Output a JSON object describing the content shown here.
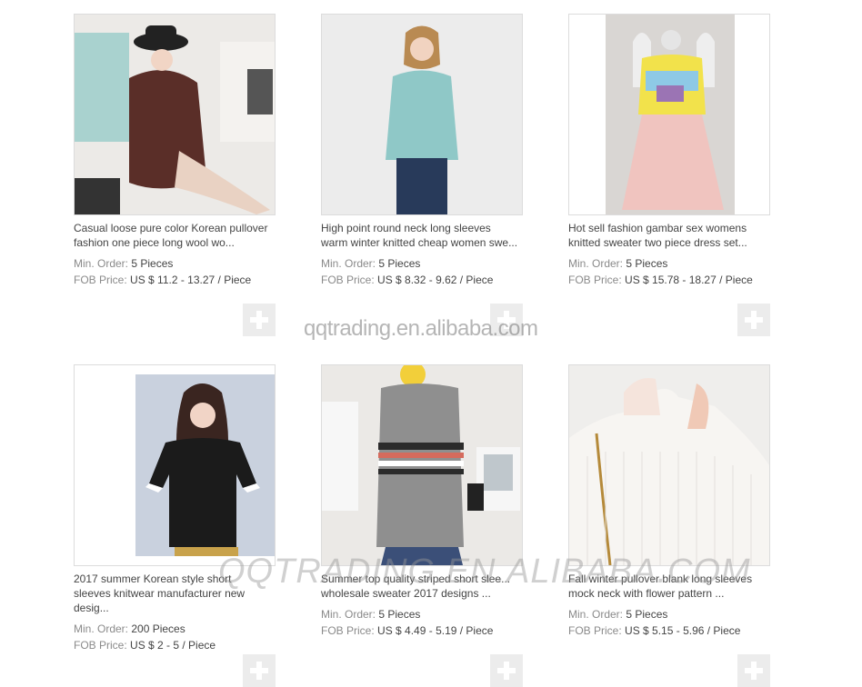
{
  "labels": {
    "min_order": "Min. Order:",
    "fob_price": "FOB Price:"
  },
  "watermarks": {
    "small": "qqtrading.en.alibaba.com",
    "large": "QQTRADING.EN.ALIBABA.COM"
  },
  "products": [
    {
      "title_lines": [
        "Casual loose pure color Korean pullover",
        "fashion one piece long wool wo..."
      ],
      "min_order": "5 Pieces",
      "fob_price": "US $ 11.2 - 13.27 / Piece"
    },
    {
      "title_lines": [
        "High point round neck long sleeves",
        "warm winter knitted cheap women swe..."
      ],
      "min_order": "5 Pieces",
      "fob_price": "US $ 8.32 - 9.62 / Piece"
    },
    {
      "title_lines": [
        "Hot sell fashion gambar sex womens",
        "knitted sweater two piece dress set..."
      ],
      "min_order": "5 Pieces",
      "fob_price": "US $ 15.78 - 18.27 / Piece"
    },
    {
      "title_lines": [
        "2017 summer Korean style short",
        "sleeves knitwear manufacturer new",
        "desig..."
      ],
      "min_order": "200 Pieces",
      "fob_price": "US $ 2 - 5 / Piece"
    },
    {
      "title_lines": [
        "Summer top quality striped short slee...",
        "wholesale sweater 2017 designs ..."
      ],
      "min_order": "5 Pieces",
      "fob_price": "US $ 4.49 - 5.19 / Piece"
    },
    {
      "title_lines": [
        "Fall winter pullover blank long sleeves",
        "mock neck with flower pattern ..."
      ],
      "min_order": "5 Pieces",
      "fob_price": "US $ 5.15 - 5.96 / Piece"
    }
  ]
}
